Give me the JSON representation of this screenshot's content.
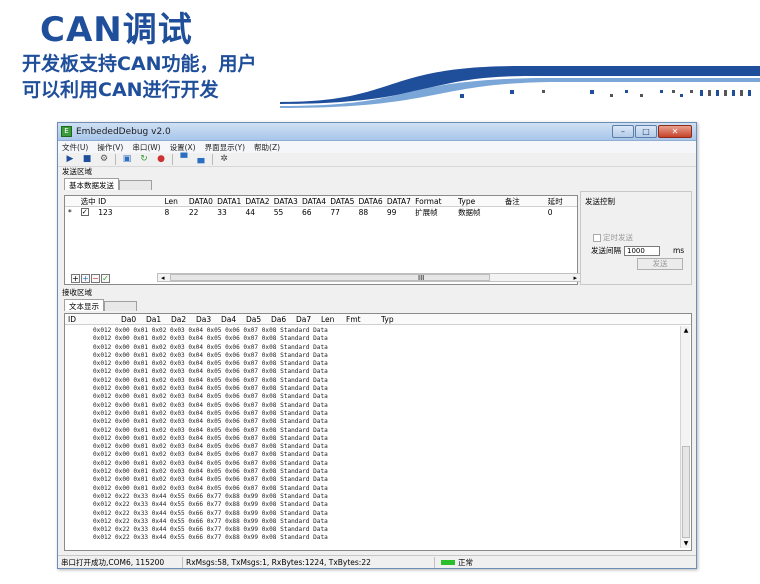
{
  "slide": {
    "title": "CAN调试",
    "subtitle_lines": [
      "开发板支持CAN功能，用户",
      "可以利用CAN进行开发"
    ]
  },
  "window": {
    "title": "EmbededDebug v2.0",
    "menu": [
      "文件(U)",
      "操作(V)",
      "串口(W)",
      "设置(X)",
      "界面显示(Y)",
      "帮助(Z)"
    ]
  },
  "send_group": {
    "label": "发送区域",
    "tab": "基本数据发送",
    "columns": [
      "选中",
      "ID",
      "Len",
      "DATA0",
      "DATA1",
      "DATA2",
      "DATA3",
      "DATA4",
      "DATA5",
      "DATA6",
      "DATA7",
      "Format",
      "Type",
      "备注",
      "延时"
    ],
    "row": {
      "marker": "*",
      "checked": "✓",
      "id": "123",
      "len": "8",
      "data": [
        "22",
        "33",
        "44",
        "55",
        "66",
        "77",
        "88",
        "99"
      ],
      "format": "扩展帧",
      "type": "数据帧",
      "note": "",
      "delay": "0"
    },
    "scroll_mark": "III"
  },
  "send_control": {
    "title": "发送控制",
    "timed_send_label": "定时发送",
    "interval_label": "发送间隔",
    "interval_value": "1000",
    "interval_unit": "ms",
    "send_button": "发送"
  },
  "recv_group": {
    "label": "接收区域",
    "tab": "文本显示",
    "columns": [
      "ID",
      "Da0",
      "Da1",
      "Da2",
      "Da3",
      "Da4",
      "Da5",
      "Da6",
      "Da7",
      "Len",
      "Fmt",
      "Typ"
    ],
    "rows": [
      [
        "0x012",
        "0x00",
        "0x01",
        "0x02",
        "0x03",
        "0x04",
        "0x05",
        "0x06",
        "0x07",
        "0x08",
        "Standard",
        "Data"
      ],
      [
        "0x012",
        "0x00",
        "0x01",
        "0x02",
        "0x03",
        "0x04",
        "0x05",
        "0x06",
        "0x07",
        "0x08",
        "Standard",
        "Data"
      ],
      [
        "0x012",
        "0x00",
        "0x01",
        "0x02",
        "0x03",
        "0x04",
        "0x05",
        "0x06",
        "0x07",
        "0x08",
        "Standard",
        "Data"
      ],
      [
        "0x012",
        "0x00",
        "0x01",
        "0x02",
        "0x03",
        "0x04",
        "0x05",
        "0x06",
        "0x07",
        "0x08",
        "Standard",
        "Data"
      ],
      [
        "0x012",
        "0x00",
        "0x01",
        "0x02",
        "0x03",
        "0x04",
        "0x05",
        "0x06",
        "0x07",
        "0x08",
        "Standard",
        "Data"
      ],
      [
        "0x012",
        "0x00",
        "0x01",
        "0x02",
        "0x03",
        "0x04",
        "0x05",
        "0x06",
        "0x07",
        "0x08",
        "Standard",
        "Data"
      ],
      [
        "0x012",
        "0x00",
        "0x01",
        "0x02",
        "0x03",
        "0x04",
        "0x05",
        "0x06",
        "0x07",
        "0x08",
        "Standard",
        "Data"
      ],
      [
        "0x012",
        "0x00",
        "0x01",
        "0x02",
        "0x03",
        "0x04",
        "0x05",
        "0x06",
        "0x07",
        "0x08",
        "Standard",
        "Data"
      ],
      [
        "0x012",
        "0x00",
        "0x01",
        "0x02",
        "0x03",
        "0x04",
        "0x05",
        "0x06",
        "0x07",
        "0x08",
        "Standard",
        "Data"
      ],
      [
        "0x012",
        "0x00",
        "0x01",
        "0x02",
        "0x03",
        "0x04",
        "0x05",
        "0x06",
        "0x07",
        "0x08",
        "Standard",
        "Data"
      ],
      [
        "0x012",
        "0x00",
        "0x01",
        "0x02",
        "0x03",
        "0x04",
        "0x05",
        "0x06",
        "0x07",
        "0x08",
        "Standard",
        "Data"
      ],
      [
        "0x012",
        "0x00",
        "0x01",
        "0x02",
        "0x03",
        "0x04",
        "0x05",
        "0x06",
        "0x07",
        "0x08",
        "Standard",
        "Data"
      ],
      [
        "0x012",
        "0x00",
        "0x01",
        "0x02",
        "0x03",
        "0x04",
        "0x05",
        "0x06",
        "0x07",
        "0x08",
        "Standard",
        "Data"
      ],
      [
        "0x012",
        "0x00",
        "0x01",
        "0x02",
        "0x03",
        "0x04",
        "0x05",
        "0x06",
        "0x07",
        "0x08",
        "Standard",
        "Data"
      ],
      [
        "0x012",
        "0x00",
        "0x01",
        "0x02",
        "0x03",
        "0x04",
        "0x05",
        "0x06",
        "0x07",
        "0x08",
        "Standard",
        "Data"
      ],
      [
        "0x012",
        "0x00",
        "0x01",
        "0x02",
        "0x03",
        "0x04",
        "0x05",
        "0x06",
        "0x07",
        "0x08",
        "Standard",
        "Data"
      ],
      [
        "0x012",
        "0x00",
        "0x01",
        "0x02",
        "0x03",
        "0x04",
        "0x05",
        "0x06",
        "0x07",
        "0x08",
        "Standard",
        "Data"
      ],
      [
        "0x012",
        "0x00",
        "0x01",
        "0x02",
        "0x03",
        "0x04",
        "0x05",
        "0x06",
        "0x07",
        "0x08",
        "Standard",
        "Data"
      ],
      [
        "0x012",
        "0x00",
        "0x01",
        "0x02",
        "0x03",
        "0x04",
        "0x05",
        "0x06",
        "0x07",
        "0x08",
        "Standard",
        "Data"
      ],
      [
        "0x012",
        "0x00",
        "0x01",
        "0x02",
        "0x03",
        "0x04",
        "0x05",
        "0x06",
        "0x07",
        "0x08",
        "Standard",
        "Data"
      ],
      [
        "0x012",
        "0x22",
        "0x33",
        "0x44",
        "0x55",
        "0x66",
        "0x77",
        "0x88",
        "0x99",
        "0x08",
        "Standard",
        "Data"
      ],
      [
        "0x012",
        "0x22",
        "0x33",
        "0x44",
        "0x55",
        "0x66",
        "0x77",
        "0x88",
        "0x99",
        "0x08",
        "Standard",
        "Data"
      ],
      [
        "0x012",
        "0x22",
        "0x33",
        "0x44",
        "0x55",
        "0x66",
        "0x77",
        "0x88",
        "0x99",
        "0x08",
        "Standard",
        "Data"
      ],
      [
        "0x012",
        "0x22",
        "0x33",
        "0x44",
        "0x55",
        "0x66",
        "0x77",
        "0x88",
        "0x99",
        "0x08",
        "Standard",
        "Data"
      ],
      [
        "0x012",
        "0x22",
        "0x33",
        "0x44",
        "0x55",
        "0x66",
        "0x77",
        "0x88",
        "0x99",
        "0x08",
        "Standard",
        "Data"
      ],
      [
        "0x012",
        "0x22",
        "0x33",
        "0x44",
        "0x55",
        "0x66",
        "0x77",
        "0x88",
        "0x99",
        "0x08",
        "Standard",
        "Data"
      ]
    ]
  },
  "status": {
    "port": "串口打开成功,COM6, 115200",
    "counters": "RxMsgs:58, TxMsgs:1, RxBytes:1224, TxBytes:22",
    "state": "正常"
  },
  "colors": {
    "title_blue": "#1f4e9a",
    "status_led": "#2bbf2b"
  }
}
